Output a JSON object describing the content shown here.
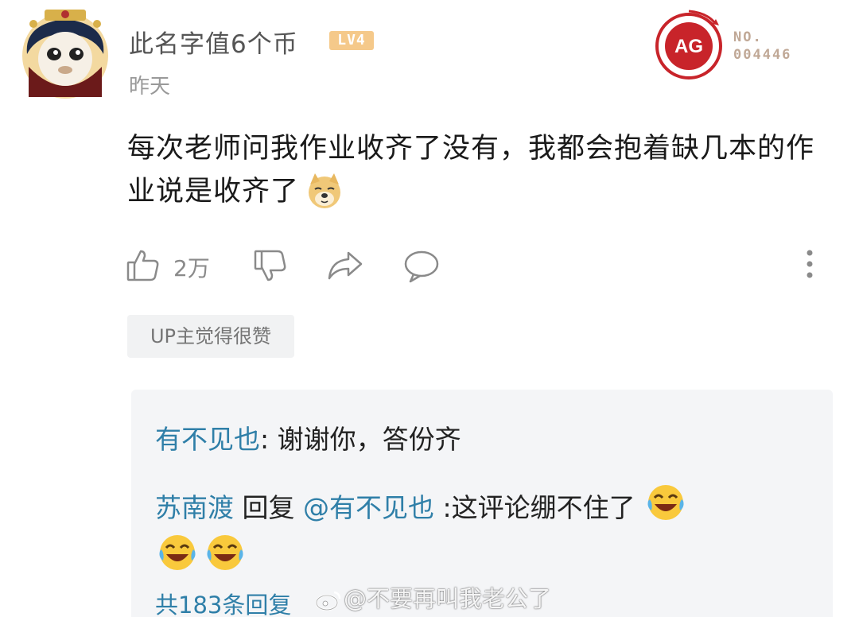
{
  "comment": {
    "username": "此名字值6个币",
    "level_badge": "LV4",
    "timestamp": "昨天",
    "fan_badge": {
      "no_label": "NO.",
      "number": "004446"
    },
    "text": "每次老师问我作业收齐了没有，我都会抱着缺几本的作业说是收齐了",
    "emoji": "doge-icon",
    "likes": "2万",
    "up_tag": "UP主觉得很赞"
  },
  "replies": {
    "first": {
      "author": "有不见也",
      "text": ": 谢谢你，答份齐"
    },
    "second": {
      "author": "苏南渡",
      "reply_word": " 回复 ",
      "mention": "@有不见也",
      "text": " :这评论绷不住了",
      "emoji": "tears-of-joy-icon"
    },
    "total": "共183条回复",
    "watermark": "@不要再叫我老公了"
  },
  "colors": {
    "link": "#2f7fa8",
    "badge": "#f5c98a",
    "fan_badge_red": "#c8242a"
  }
}
